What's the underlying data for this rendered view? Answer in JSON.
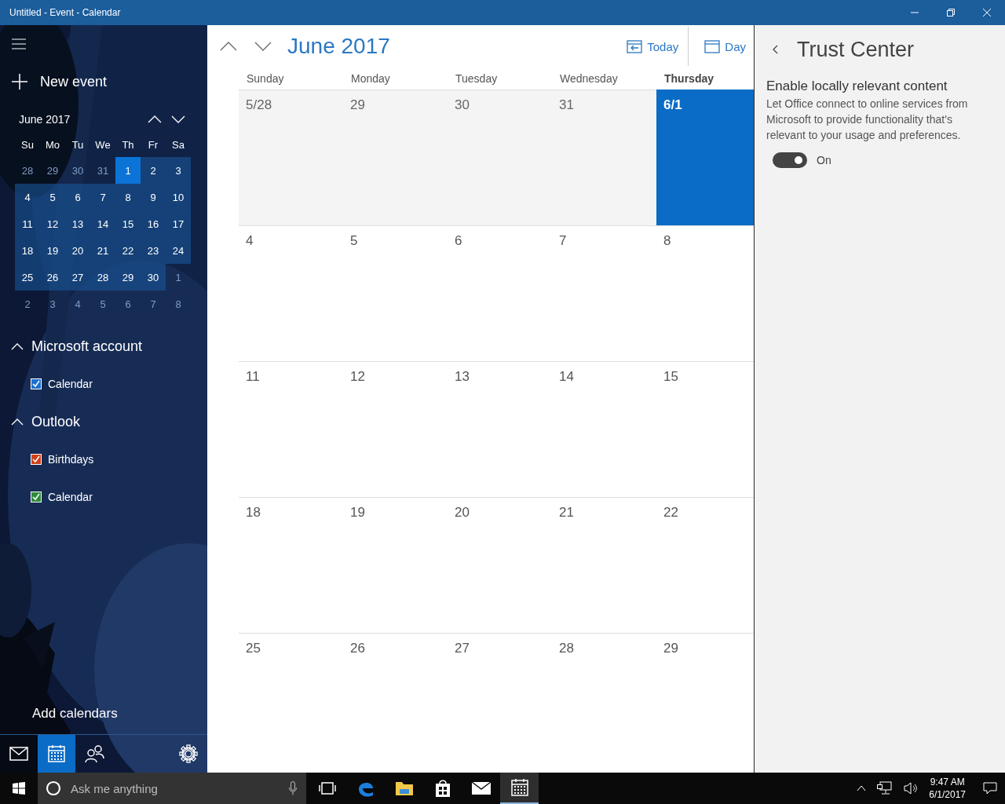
{
  "window": {
    "title": "Untitled - Event - Calendar"
  },
  "sidebar": {
    "new_event": "New event",
    "mini_calendar": {
      "title": "June 2017",
      "weekdays": [
        "Su",
        "Mo",
        "Tu",
        "We",
        "Th",
        "Fr",
        "Sa"
      ],
      "weeks": [
        [
          {
            "day": "28",
            "in_month": false,
            "selected": false
          },
          {
            "day": "29",
            "in_month": false,
            "selected": false
          },
          {
            "day": "30",
            "in_month": false,
            "selected": false
          },
          {
            "day": "31",
            "in_month": false,
            "selected": false
          },
          {
            "day": "1",
            "in_month": true,
            "selected": true
          },
          {
            "day": "2",
            "in_month": true,
            "selected": false
          },
          {
            "day": "3",
            "in_month": true,
            "selected": false
          }
        ],
        [
          {
            "day": "4",
            "in_month": true,
            "selected": false
          },
          {
            "day": "5",
            "in_month": true,
            "selected": false
          },
          {
            "day": "6",
            "in_month": true,
            "selected": false
          },
          {
            "day": "7",
            "in_month": true,
            "selected": false
          },
          {
            "day": "8",
            "in_month": true,
            "selected": false
          },
          {
            "day": "9",
            "in_month": true,
            "selected": false
          },
          {
            "day": "10",
            "in_month": true,
            "selected": false
          }
        ],
        [
          {
            "day": "11",
            "in_month": true,
            "selected": false
          },
          {
            "day": "12",
            "in_month": true,
            "selected": false
          },
          {
            "day": "13",
            "in_month": true,
            "selected": false
          },
          {
            "day": "14",
            "in_month": true,
            "selected": false
          },
          {
            "day": "15",
            "in_month": true,
            "selected": false
          },
          {
            "day": "16",
            "in_month": true,
            "selected": false
          },
          {
            "day": "17",
            "in_month": true,
            "selected": false
          }
        ],
        [
          {
            "day": "18",
            "in_month": true,
            "selected": false
          },
          {
            "day": "19",
            "in_month": true,
            "selected": false
          },
          {
            "day": "20",
            "in_month": true,
            "selected": false
          },
          {
            "day": "21",
            "in_month": true,
            "selected": false
          },
          {
            "day": "22",
            "in_month": true,
            "selected": false
          },
          {
            "day": "23",
            "in_month": true,
            "selected": false
          },
          {
            "day": "24",
            "in_month": true,
            "selected": false
          }
        ],
        [
          {
            "day": "25",
            "in_month": true,
            "selected": false
          },
          {
            "day": "26",
            "in_month": true,
            "selected": false
          },
          {
            "day": "27",
            "in_month": true,
            "selected": false
          },
          {
            "day": "28",
            "in_month": true,
            "selected": false
          },
          {
            "day": "29",
            "in_month": true,
            "selected": false
          },
          {
            "day": "30",
            "in_month": true,
            "selected": false
          },
          {
            "day": "1",
            "in_month": false,
            "selected": false
          }
        ],
        [
          {
            "day": "2",
            "in_month": false,
            "selected": false
          },
          {
            "day": "3",
            "in_month": false,
            "selected": false
          },
          {
            "day": "4",
            "in_month": false,
            "selected": false
          },
          {
            "day": "5",
            "in_month": false,
            "selected": false
          },
          {
            "day": "6",
            "in_month": false,
            "selected": false
          },
          {
            "day": "7",
            "in_month": false,
            "selected": false
          },
          {
            "day": "8",
            "in_month": false,
            "selected": false
          }
        ]
      ]
    },
    "accounts": [
      {
        "name": "Microsoft account",
        "expanded": true,
        "calendars": [
          {
            "name": "Calendar",
            "checked": true,
            "color": "#1e6fd0"
          }
        ]
      },
      {
        "name": "Outlook",
        "expanded": true,
        "calendars": [
          {
            "name": "Birthdays",
            "checked": true,
            "color": "#d0421b"
          },
          {
            "name": "Calendar",
            "checked": true,
            "color": "#2f8a3b"
          }
        ]
      }
    ],
    "add_calendars": "Add calendars",
    "nav": [
      {
        "kind": "mail",
        "selected": false
      },
      {
        "kind": "calendar",
        "selected": true
      },
      {
        "kind": "people",
        "selected": false
      },
      {
        "kind": "settings",
        "selected": false
      }
    ]
  },
  "main": {
    "title": "June 2017",
    "today_button": "Today",
    "view_button": "Day",
    "weekdays": [
      {
        "label": "Sunday",
        "selected": false
      },
      {
        "label": "Monday",
        "selected": false
      },
      {
        "label": "Tuesday",
        "selected": false
      },
      {
        "label": "Wednesday",
        "selected": false
      },
      {
        "label": "Thursday",
        "selected": true
      }
    ],
    "weeks": [
      [
        {
          "label": "5/28",
          "in_month": false,
          "today": false
        },
        {
          "label": "29",
          "in_month": false,
          "today": false
        },
        {
          "label": "30",
          "in_month": false,
          "today": false
        },
        {
          "label": "31",
          "in_month": false,
          "today": false
        },
        {
          "label": "6/1",
          "in_month": true,
          "today": true
        }
      ],
      [
        {
          "label": "4",
          "in_month": true,
          "today": false
        },
        {
          "label": "5",
          "in_month": true,
          "today": false
        },
        {
          "label": "6",
          "in_month": true,
          "today": false
        },
        {
          "label": "7",
          "in_month": true,
          "today": false
        },
        {
          "label": "8",
          "in_month": true,
          "today": false
        }
      ],
      [
        {
          "label": "11",
          "in_month": true,
          "today": false
        },
        {
          "label": "12",
          "in_month": true,
          "today": false
        },
        {
          "label": "13",
          "in_month": true,
          "today": false
        },
        {
          "label": "14",
          "in_month": true,
          "today": false
        },
        {
          "label": "15",
          "in_month": true,
          "today": false
        }
      ],
      [
        {
          "label": "18",
          "in_month": true,
          "today": false
        },
        {
          "label": "19",
          "in_month": true,
          "today": false
        },
        {
          "label": "20",
          "in_month": true,
          "today": false
        },
        {
          "label": "21",
          "in_month": true,
          "today": false
        },
        {
          "label": "22",
          "in_month": true,
          "today": false
        }
      ],
      [
        {
          "label": "25",
          "in_month": true,
          "today": false
        },
        {
          "label": "26",
          "in_month": true,
          "today": false
        },
        {
          "label": "27",
          "in_month": true,
          "today": false
        },
        {
          "label": "28",
          "in_month": true,
          "today": false
        },
        {
          "label": "29",
          "in_month": true,
          "today": false
        }
      ]
    ]
  },
  "trust_center": {
    "title": "Trust Center",
    "settings": [
      {
        "title": "Enable locally relevant content",
        "description": "Let Office connect to online services from Microsoft to provide functionality that's relevant to your usage and preferences.",
        "on": true,
        "state_label": "On"
      }
    ]
  },
  "taskbar": {
    "search": {
      "placeholder": "Ask me anything"
    },
    "apps": [
      {
        "kind": "task-view",
        "selected": false
      },
      {
        "kind": "edge",
        "selected": false
      },
      {
        "kind": "explorer",
        "selected": false
      },
      {
        "kind": "store",
        "selected": false
      },
      {
        "kind": "mail",
        "selected": false
      },
      {
        "kind": "calendar",
        "selected": true
      }
    ],
    "time": "9:47 AM",
    "date": "6/1/2017"
  }
}
